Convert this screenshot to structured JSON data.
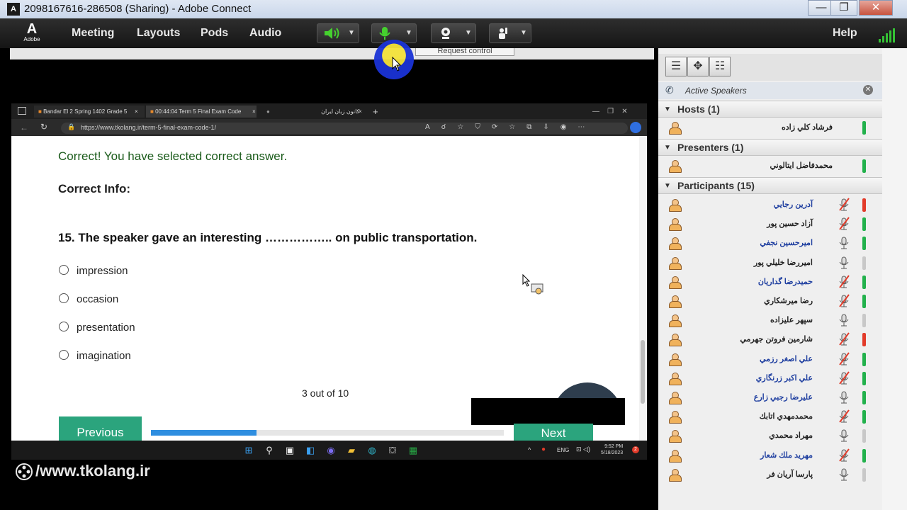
{
  "window": {
    "title": "2098167616-286508 (Sharing) - Adobe Connect",
    "app_icon": "adobe-connect-icon",
    "controls": {
      "minimize": "—",
      "maximize": "❐",
      "close": "✕"
    }
  },
  "menubar": {
    "logo": "Adobe",
    "logo_glyph": "A",
    "items": [
      "Meeting",
      "Layouts",
      "Pods",
      "Audio"
    ],
    "help": "Help",
    "icons": [
      "speaker-icon",
      "microphone-icon",
      "webcam-icon",
      "raise-hand-icon",
      "signal-strength-icon"
    ]
  },
  "share": {
    "request_control": "Request control"
  },
  "browser": {
    "tabs": [
      {
        "label": "Bandar El 2 Spring 1402 Grade 5",
        "close": "×"
      },
      {
        "label": "00:44:04 Term 5 Final Exam Code",
        "close": "×"
      },
      {
        "label": "کانون زبان ایران",
        "close": "×"
      }
    ],
    "new_tab": "+",
    "url": "https://www.tkolang.ir/term-5-final-exam-code-1/"
  },
  "quiz": {
    "correct_message": "Correct! You have selected correct answer.",
    "correct_info_label": "Correct Info:",
    "question": "15. The speaker gave an interesting …………….. on public transportation.",
    "options": [
      "impression",
      "occasion",
      "presentation",
      "imagination"
    ],
    "progress_text": "3 out of 10",
    "progress_fraction": 0.3,
    "previous_label": "Previous",
    "next_label": "Next"
  },
  "taskbar": {
    "language": "ENG",
    "time": "9:52 PM",
    "date": "5/18/2023",
    "notification_count": "2",
    "icons": [
      "windows-start-icon",
      "search-icon",
      "task-view-icon",
      "widgets-icon",
      "chat-icon",
      "file-explorer-icon",
      "edge-icon",
      "store-icon",
      "excel-icon"
    ]
  },
  "watermark": "/www.tkolang.ir",
  "panel": {
    "active_speakers": "Active Speakers",
    "hosts": {
      "label": "Hosts (1)",
      "members": [
        {
          "name": "فرشاد كلي زاده",
          "status": "green"
        }
      ]
    },
    "presenters": {
      "label": "Presenters (1)",
      "members": [
        {
          "name": "محمدفاضل ايتالوني",
          "status": "green"
        }
      ]
    },
    "participants": {
      "label": "Participants (15)",
      "members": [
        {
          "name": "آدرين رجايي",
          "color": "#1f3fa0",
          "mic": "muted",
          "status": "red"
        },
        {
          "name": "آزاد حسين پور",
          "color": "#222222",
          "mic": "muted",
          "status": "green"
        },
        {
          "name": "اميرحسين نجفي",
          "color": "#1f3fa0",
          "mic": "on",
          "status": "green"
        },
        {
          "name": "اميررضا خليلي پور",
          "color": "#222222",
          "mic": "on",
          "status": "gray"
        },
        {
          "name": "حميدرضا گداريان",
          "color": "#1f3fa0",
          "mic": "muted",
          "status": "green"
        },
        {
          "name": "رضا ميرشكاري",
          "color": "#222222",
          "mic": "muted",
          "status": "green"
        },
        {
          "name": "سپهر عليزاده",
          "color": "#222222",
          "mic": "on",
          "status": "gray"
        },
        {
          "name": "شارمين فروتن جهرمي",
          "color": "#222222",
          "mic": "muted",
          "status": "red"
        },
        {
          "name": "علي اصغر رزمي",
          "color": "#1f3fa0",
          "mic": "muted",
          "status": "green"
        },
        {
          "name": "علي اكبر زرنگاري",
          "color": "#1f3fa0",
          "mic": "muted",
          "status": "green"
        },
        {
          "name": "عليرضا رجبي زارع",
          "color": "#1f3fa0",
          "mic": "on",
          "status": "green"
        },
        {
          "name": "محمدمهدي اتابك",
          "color": "#222222",
          "mic": "muted",
          "status": "green"
        },
        {
          "name": "مهراد محمدي",
          "color": "#222222",
          "mic": "on",
          "status": "gray"
        },
        {
          "name": "مهريد ملك شعار",
          "color": "#1f3fa0",
          "mic": "muted",
          "status": "green"
        },
        {
          "name": "پارسا آريان فر",
          "color": "#222222",
          "mic": "on",
          "status": "gray"
        }
      ]
    }
  },
  "colors": {
    "accent_green": "#2ba47d",
    "status_green": "#22b14c",
    "status_red": "#e23b2a",
    "status_gray": "#c8c8c8",
    "progress_blue": "#2f8ee0"
  }
}
